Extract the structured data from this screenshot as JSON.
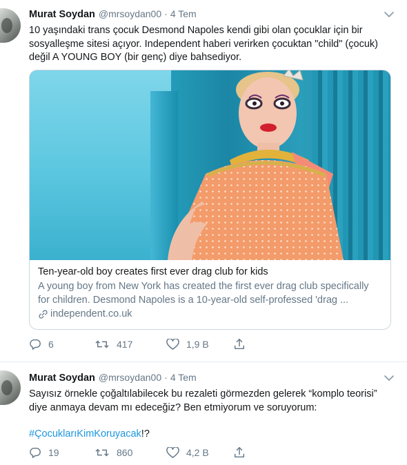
{
  "tweets": [
    {
      "author_name": "Murat Soydan",
      "handle": "@mrsoydan00",
      "separator": "·",
      "date": "4 Tem",
      "text_lines": [
        "10 yaşındaki trans çocuk Desmond Napoles kendi gibi olan çocuklar için bir",
        "sosyalleşme sitesi açıyor. Independent haberi verirken çocuktan \"child\" (çocuk)",
        "değil A YOUNG BOY (bir genç) diye bahsediyor."
      ],
      "card": {
        "title": "Ten-year-old boy creates first ever drag club for kids",
        "desc_line1": "A young boy from New York has created the first ever drag club specifically",
        "desc_line2": "for children.  Desmond Napoles is a 10-year-old self-professed 'drag ...",
        "domain": "independent.co.uk"
      },
      "replies": "6",
      "retweets": "417",
      "likes": "1,9 B"
    },
    {
      "author_name": "Murat Soydan",
      "handle": "@mrsoydan00",
      "separator": "·",
      "date": "4 Tem",
      "text_lines": [
        "Sayısız örnekle çoğaltılabilecek bu rezaleti görmezden gelerek “komplo teorisi”",
        "diye anmaya devam mı edeceğiz? Ben etmiyorum ve soruyorum:"
      ],
      "hashtag": "#ÇocuklarıKimKoruyacak",
      "hashtag_suffix": "!?",
      "replies": "19",
      "retweets": "860",
      "likes": "4,2 B"
    }
  ],
  "icons": {
    "reply": "reply-icon",
    "retweet": "retweet-icon",
    "like": "heart-icon",
    "share": "share-icon",
    "more": "chevron-down-icon",
    "link": "link-icon"
  },
  "colors": {
    "text": "#14171a",
    "muted": "#657786",
    "link": "#1b95e0",
    "border": "#e6ecf0"
  }
}
